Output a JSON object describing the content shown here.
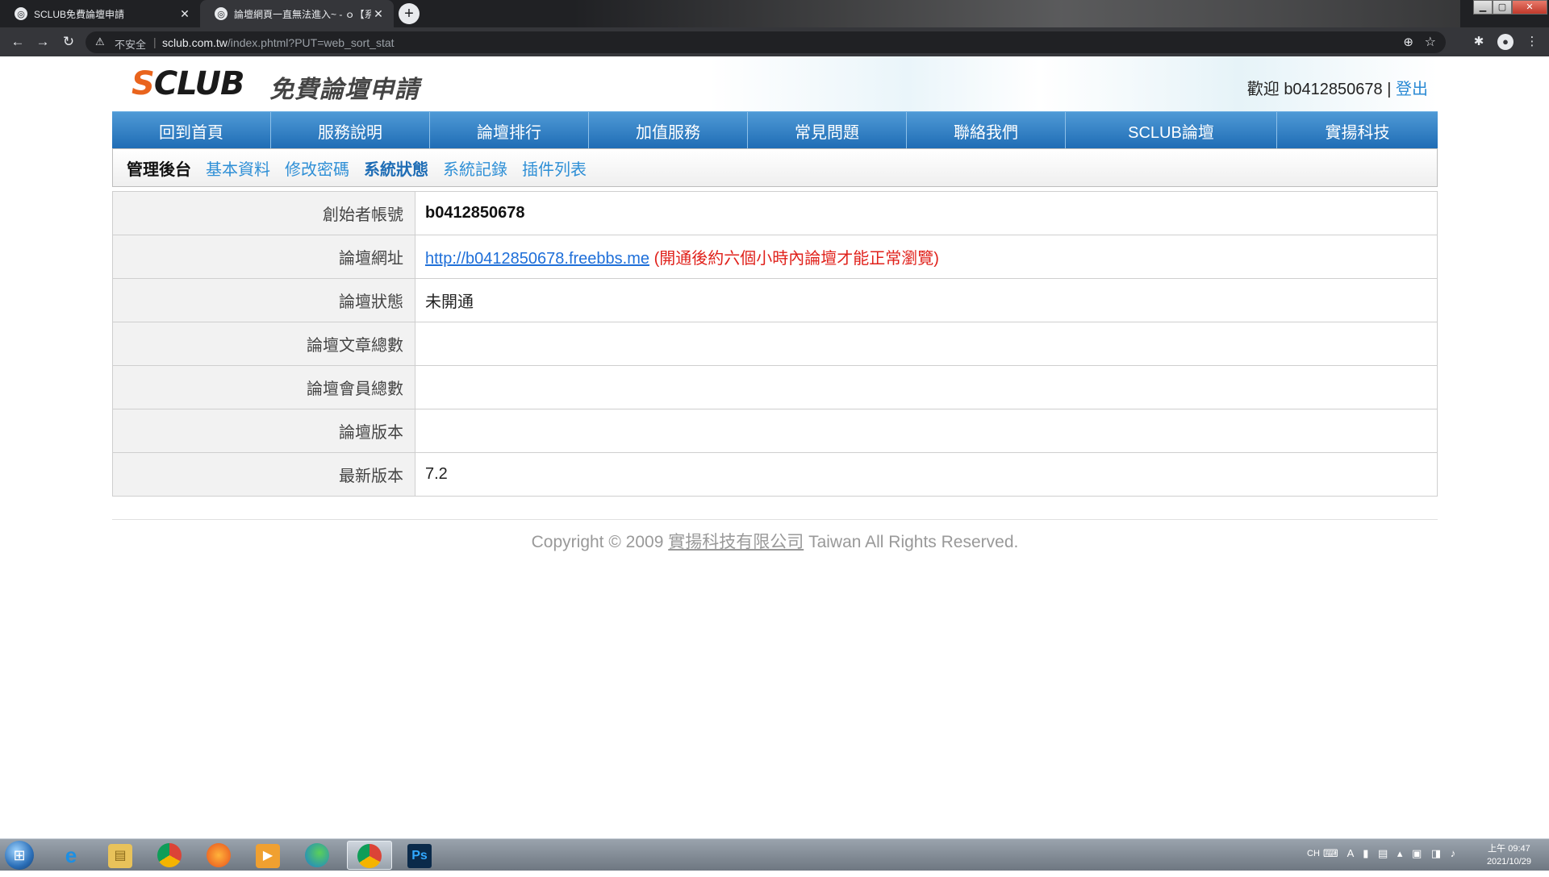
{
  "browser": {
    "tabs": [
      {
        "title": "SCLUB免費論壇申請",
        "active": false
      },
      {
        "title": "論壇網頁一直無法進入~ - ｏ【系",
        "active": true
      }
    ],
    "address": {
      "insecure_label": "不安全",
      "domain": "sclub.com.tw",
      "path": "/index.phtml?PUT=web_sort_stat"
    }
  },
  "header": {
    "logo_s": "S",
    "logo_rest": "CLUB",
    "logo_subtitle": "免費論壇申請",
    "welcome_prefix": "歡迎",
    "username": "b0412850678",
    "separator": "|",
    "logout_label": "登出"
  },
  "mainnav": [
    {
      "label": "回到首頁"
    },
    {
      "label": "服務說明"
    },
    {
      "label": "論壇排行"
    },
    {
      "label": "加值服務"
    },
    {
      "label": "常見問題"
    },
    {
      "label": "聯絡我們"
    },
    {
      "label": "SCLUB論壇"
    },
    {
      "label": "實揚科技"
    }
  ],
  "subnav": {
    "current": "管理後台",
    "items": [
      {
        "label": "基本資料"
      },
      {
        "label": "修改密碼"
      },
      {
        "label": "系統狀態",
        "active": true
      },
      {
        "label": "系統記錄"
      },
      {
        "label": "插件列表"
      }
    ]
  },
  "info": {
    "rows": [
      {
        "label": "創始者帳號",
        "value": "b0412850678"
      },
      {
        "label": "論壇網址",
        "url": "http://b0412850678.freebbs.me",
        "note": "(開通後約六個小時內論壇才能正常瀏覽)"
      },
      {
        "label": "論壇狀態",
        "value": "未開通"
      },
      {
        "label": "論壇文章總數",
        "value": ""
      },
      {
        "label": "論壇會員總數",
        "value": ""
      },
      {
        "label": "論壇版本",
        "value": ""
      },
      {
        "label": "最新版本",
        "value": "7.2"
      }
    ]
  },
  "footer": {
    "prefix": "Copyright © 2009",
    "company": "實揚科技有限公司",
    "suffix": "Taiwan All Rights Reserved."
  },
  "taskbar": {
    "lang": "CH",
    "time": "上午 09:47",
    "date": "2021/10/29",
    "apps": [
      "internet-explorer",
      "file-explorer",
      "chrome",
      "firefox",
      "media-player",
      "edge",
      "chrome",
      "photoshop"
    ],
    "ps_label": "Ps"
  },
  "colors": {
    "nav_blue": "#1f6db5",
    "logo_orange": "#e9641d",
    "link_blue": "#2e8fd6",
    "note_red": "#e0211b"
  }
}
